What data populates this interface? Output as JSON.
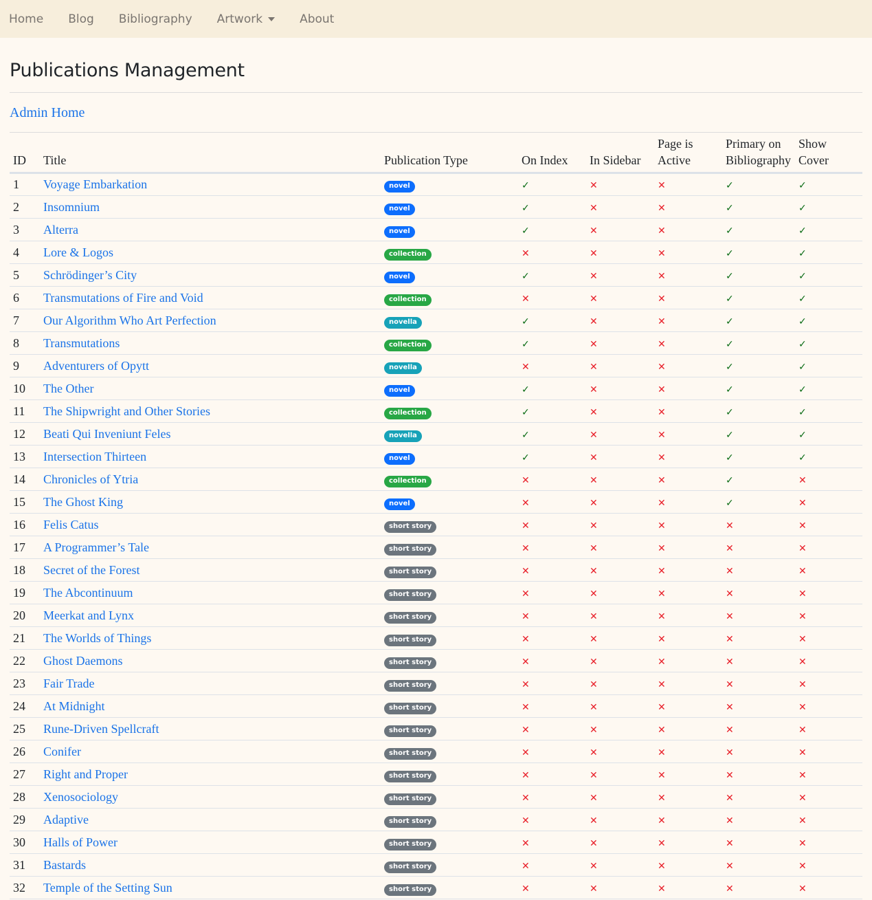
{
  "nav": {
    "items": [
      {
        "label": "Home",
        "dropdown": false
      },
      {
        "label": "Blog",
        "dropdown": false
      },
      {
        "label": "Bibliography",
        "dropdown": false
      },
      {
        "label": "Artwork",
        "dropdown": true
      },
      {
        "label": "About",
        "dropdown": false
      }
    ]
  },
  "page": {
    "title": "Publications Management",
    "admin_home_link": "Admin Home"
  },
  "colors": {
    "novel": "#0d6efd",
    "collection": "#28a745",
    "novella": "#17a2b8",
    "short story": "#6c757d",
    "check": "#0a6b14",
    "cross": "#e8202a"
  },
  "icons": {
    "check": "✓",
    "cross": "✕"
  },
  "table": {
    "headers": {
      "id": "ID",
      "title": "Title",
      "type": "Publication Type",
      "on_index": "On Index",
      "in_sidebar": "In Sidebar",
      "page_active_1": "Page is",
      "page_active_2": "Active",
      "primary_1": "Primary on",
      "primary_2": "Bibliography",
      "show_cover": "Show Cover"
    },
    "rows": [
      {
        "id": "1",
        "title": "Voyage Embarkation",
        "type": "novel",
        "on_index": true,
        "in_sidebar": false,
        "page_active": false,
        "primary": true,
        "show_cover": true
      },
      {
        "id": "2",
        "title": "Insomnium",
        "type": "novel",
        "on_index": true,
        "in_sidebar": false,
        "page_active": false,
        "primary": true,
        "show_cover": true
      },
      {
        "id": "3",
        "title": "Alterra",
        "type": "novel",
        "on_index": true,
        "in_sidebar": false,
        "page_active": false,
        "primary": true,
        "show_cover": true
      },
      {
        "id": "4",
        "title": "Lore & Logos",
        "type": "collection",
        "on_index": false,
        "in_sidebar": false,
        "page_active": false,
        "primary": true,
        "show_cover": true
      },
      {
        "id": "5",
        "title": "Schrödinger’s City",
        "type": "novel",
        "on_index": true,
        "in_sidebar": false,
        "page_active": false,
        "primary": true,
        "show_cover": true
      },
      {
        "id": "6",
        "title": "Transmutations of Fire and Void",
        "type": "collection",
        "on_index": false,
        "in_sidebar": false,
        "page_active": false,
        "primary": true,
        "show_cover": true
      },
      {
        "id": "7",
        "title": "Our Algorithm Who Art Perfection",
        "type": "novella",
        "on_index": true,
        "in_sidebar": false,
        "page_active": false,
        "primary": true,
        "show_cover": true
      },
      {
        "id": "8",
        "title": "Transmutations",
        "type": "collection",
        "on_index": true,
        "in_sidebar": false,
        "page_active": false,
        "primary": true,
        "show_cover": true
      },
      {
        "id": "9",
        "title": "Adventurers of Opytt",
        "type": "novella",
        "on_index": false,
        "in_sidebar": false,
        "page_active": false,
        "primary": true,
        "show_cover": true
      },
      {
        "id": "10",
        "title": "The Other",
        "type": "novel",
        "on_index": true,
        "in_sidebar": false,
        "page_active": false,
        "primary": true,
        "show_cover": true
      },
      {
        "id": "11",
        "title": "The Shipwright and Other Stories",
        "type": "collection",
        "on_index": true,
        "in_sidebar": false,
        "page_active": false,
        "primary": true,
        "show_cover": true
      },
      {
        "id": "12",
        "title": "Beati Qui Inveniunt Feles",
        "type": "novella",
        "on_index": true,
        "in_sidebar": false,
        "page_active": false,
        "primary": true,
        "show_cover": true
      },
      {
        "id": "13",
        "title": "Intersection Thirteen",
        "type": "novel",
        "on_index": true,
        "in_sidebar": false,
        "page_active": false,
        "primary": true,
        "show_cover": true
      },
      {
        "id": "14",
        "title": "Chronicles of Ytria",
        "type": "collection",
        "on_index": false,
        "in_sidebar": false,
        "page_active": false,
        "primary": true,
        "show_cover": false
      },
      {
        "id": "15",
        "title": "The Ghost King",
        "type": "novel",
        "on_index": false,
        "in_sidebar": false,
        "page_active": false,
        "primary": true,
        "show_cover": false
      },
      {
        "id": "16",
        "title": "Felis Catus",
        "type": "short story",
        "on_index": false,
        "in_sidebar": false,
        "page_active": false,
        "primary": false,
        "show_cover": false
      },
      {
        "id": "17",
        "title": "A Programmer’s Tale",
        "type": "short story",
        "on_index": false,
        "in_sidebar": false,
        "page_active": false,
        "primary": false,
        "show_cover": false
      },
      {
        "id": "18",
        "title": "Secret of the Forest",
        "type": "short story",
        "on_index": false,
        "in_sidebar": false,
        "page_active": false,
        "primary": false,
        "show_cover": false
      },
      {
        "id": "19",
        "title": "The Abcontinuum",
        "type": "short story",
        "on_index": false,
        "in_sidebar": false,
        "page_active": false,
        "primary": false,
        "show_cover": false
      },
      {
        "id": "20",
        "title": "Meerkat and Lynx",
        "type": "short story",
        "on_index": false,
        "in_sidebar": false,
        "page_active": false,
        "primary": false,
        "show_cover": false
      },
      {
        "id": "21",
        "title": "The Worlds of Things",
        "type": "short story",
        "on_index": false,
        "in_sidebar": false,
        "page_active": false,
        "primary": false,
        "show_cover": false
      },
      {
        "id": "22",
        "title": "Ghost Daemons",
        "type": "short story",
        "on_index": false,
        "in_sidebar": false,
        "page_active": false,
        "primary": false,
        "show_cover": false
      },
      {
        "id": "23",
        "title": "Fair Trade",
        "type": "short story",
        "on_index": false,
        "in_sidebar": false,
        "page_active": false,
        "primary": false,
        "show_cover": false
      },
      {
        "id": "24",
        "title": "At Midnight",
        "type": "short story",
        "on_index": false,
        "in_sidebar": false,
        "page_active": false,
        "primary": false,
        "show_cover": false
      },
      {
        "id": "25",
        "title": "Rune-Driven Spellcraft",
        "type": "short story",
        "on_index": false,
        "in_sidebar": false,
        "page_active": false,
        "primary": false,
        "show_cover": false
      },
      {
        "id": "26",
        "title": "Conifer",
        "type": "short story",
        "on_index": false,
        "in_sidebar": false,
        "page_active": false,
        "primary": false,
        "show_cover": false
      },
      {
        "id": "27",
        "title": "Right and Proper",
        "type": "short story",
        "on_index": false,
        "in_sidebar": false,
        "page_active": false,
        "primary": false,
        "show_cover": false
      },
      {
        "id": "28",
        "title": "Xenosociology",
        "type": "short story",
        "on_index": false,
        "in_sidebar": false,
        "page_active": false,
        "primary": false,
        "show_cover": false
      },
      {
        "id": "29",
        "title": "Adaptive",
        "type": "short story",
        "on_index": false,
        "in_sidebar": false,
        "page_active": false,
        "primary": false,
        "show_cover": false
      },
      {
        "id": "30",
        "title": "Halls of Power",
        "type": "short story",
        "on_index": false,
        "in_sidebar": false,
        "page_active": false,
        "primary": false,
        "show_cover": false
      },
      {
        "id": "31",
        "title": "Bastards",
        "type": "short story",
        "on_index": false,
        "in_sidebar": false,
        "page_active": false,
        "primary": false,
        "show_cover": false
      },
      {
        "id": "32",
        "title": "Temple of the Setting Sun",
        "type": "short story",
        "on_index": false,
        "in_sidebar": false,
        "page_active": false,
        "primary": false,
        "show_cover": false
      }
    ]
  }
}
